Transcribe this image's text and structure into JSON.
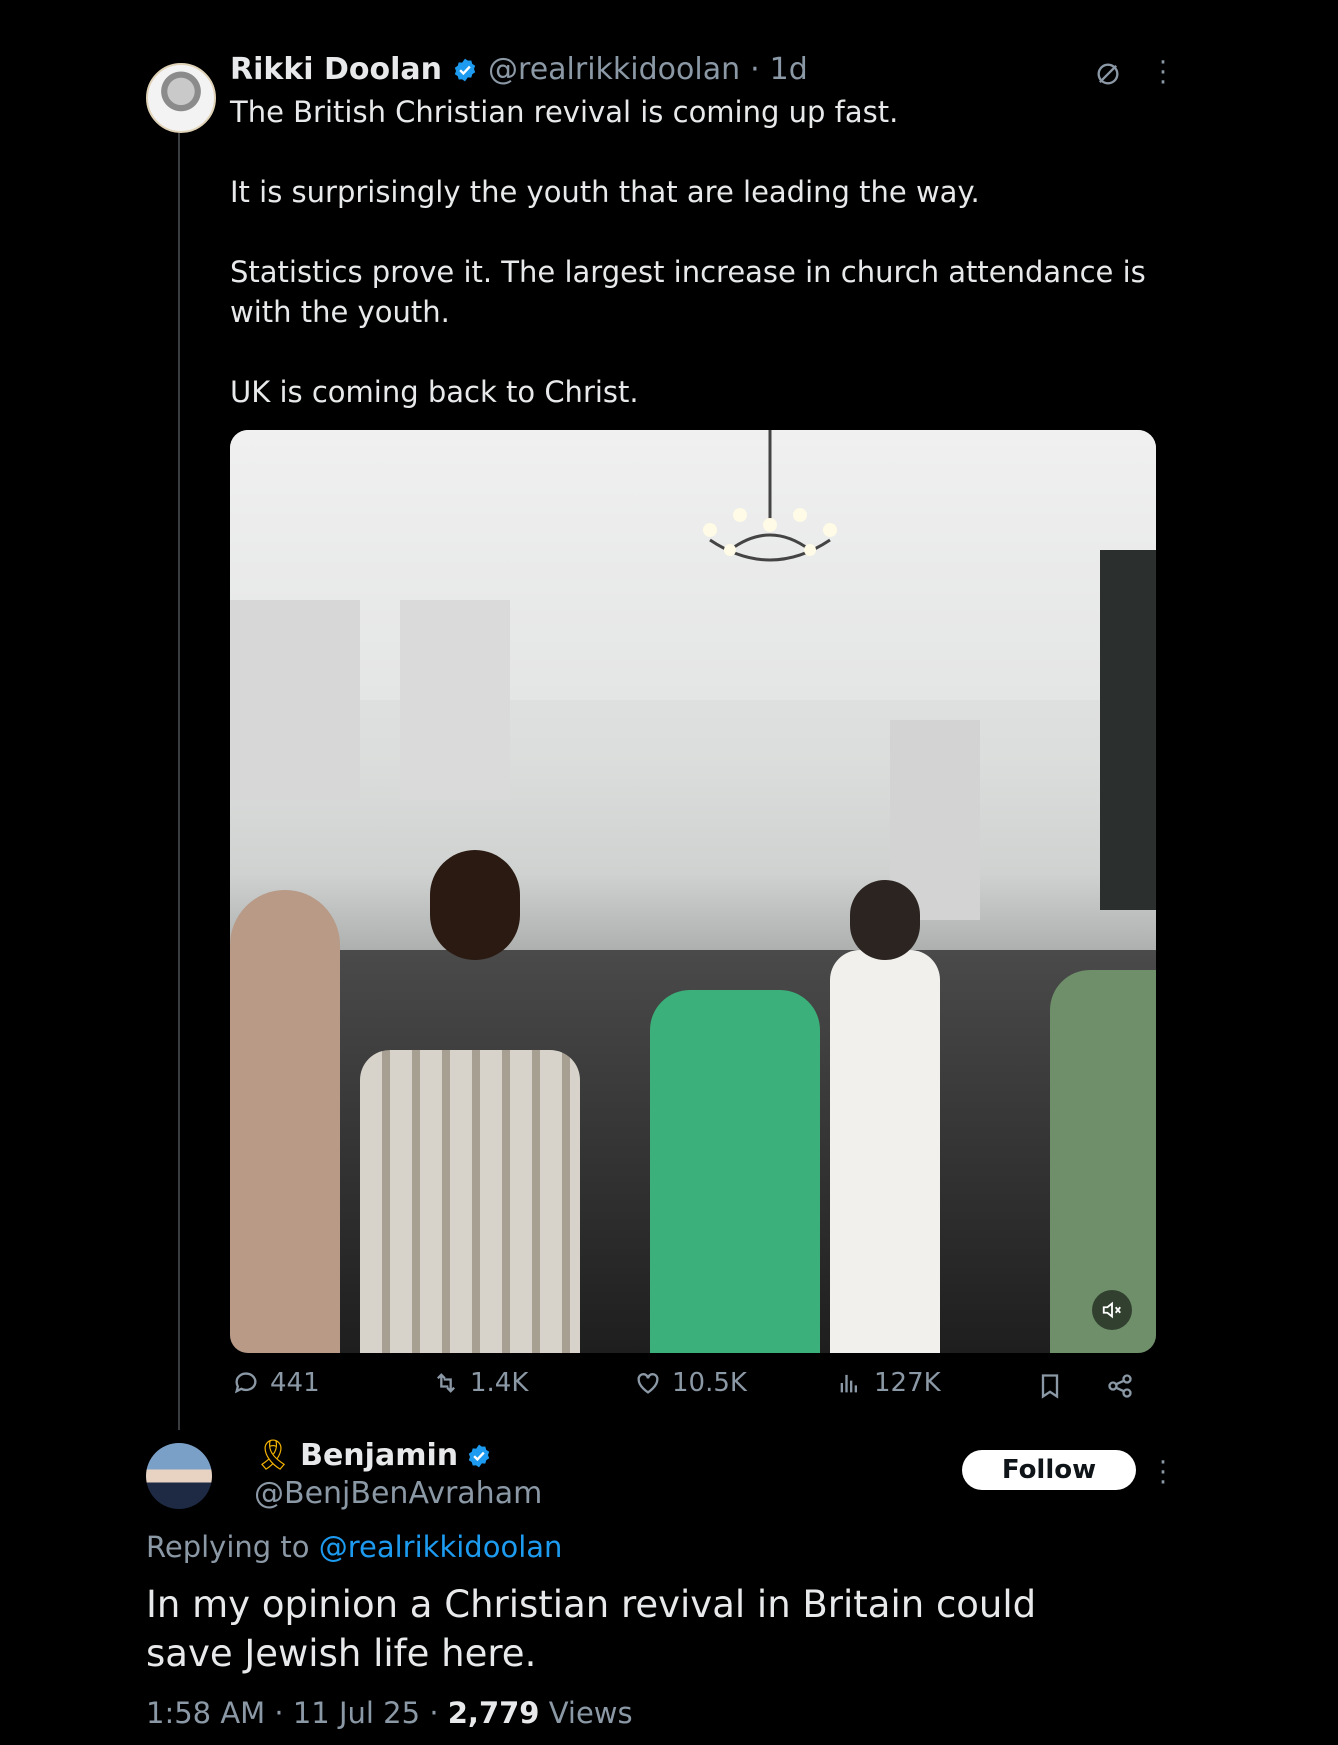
{
  "original_tweet": {
    "author_name": "Rikki Doolan",
    "handle": "@realrikkidoolan",
    "separator": "·",
    "time_ago": "1d",
    "paragraphs": [
      "The British Christian revival is coming up fast.",
      "It is surprisingly the youth that are leading the way.",
      "Statistics prove it. The largest increase in church attendance is with the youth.",
      "UK is coming back to Christ."
    ],
    "media": {
      "type": "video",
      "muted": true,
      "mute_icon": "speaker-muted-icon"
    },
    "metrics": {
      "replies": "441",
      "reposts": "1.4K",
      "likes": "10.5K",
      "views": "127K"
    }
  },
  "reply_tweet": {
    "ribbon": "🎗",
    "author_name": "Benjamin",
    "handle": "@BenjBenAvraham",
    "follow_label": "Follow",
    "replying_prefix": "Replying to",
    "replying_to": "@realrikkidoolan",
    "text": "In my opinion a Christian revival in Britain could save Jewish life here.",
    "time": "1:58 AM",
    "date": "11 Jul 25",
    "views_count": "2,779",
    "views_label": "Views"
  },
  "colors": {
    "background": "#000000",
    "text_primary": "#e7e9ea",
    "text_secondary": "#8b98a5",
    "link": "#1d9bf0",
    "verified": "#1d9bf0"
  }
}
